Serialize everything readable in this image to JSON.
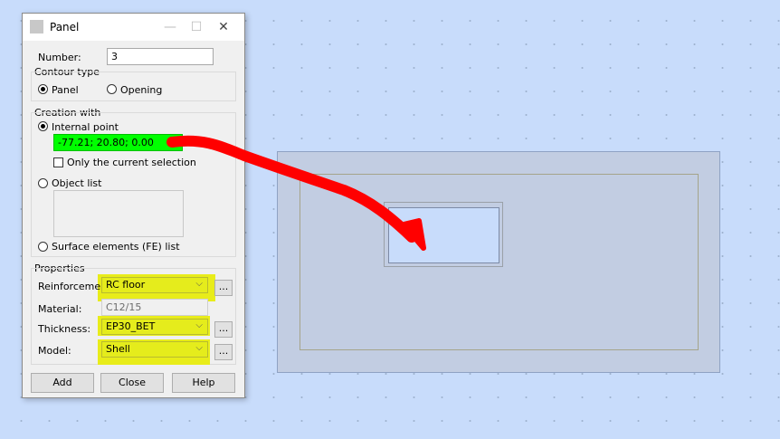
{
  "dialog": {
    "title": "Panel",
    "number_label": "Number:",
    "number_value": "3",
    "contour_type": {
      "title": "Contour type",
      "panel_label": "Panel",
      "opening_label": "Opening",
      "selected": "Panel"
    },
    "creation": {
      "title": "Creation with",
      "internal_point_label": "Internal point",
      "point_value": "-77.21; 20.80; 0.00",
      "only_selection_label": "Only the current selection",
      "object_list_label": "Object list",
      "surface_label": "Surface elements (FE) list"
    },
    "properties": {
      "title": "Properties",
      "reinforcement_label": "Reinforcement:",
      "reinforcement_value": "RC floor",
      "material_label": "Material:",
      "material_value": "C12/15",
      "thickness_label": "Thickness:",
      "thickness_value": "EP30_BET",
      "model_label": "Model:",
      "model_value": "Shell",
      "more_label": "..."
    },
    "buttons": {
      "add": "Add",
      "close": "Close",
      "help": "Help"
    }
  },
  "window_controls": {
    "minimize": "—",
    "maximize": "☐",
    "close": "✕"
  },
  "colors": {
    "highlight_green": "#00ff00",
    "highlight_yellow": "#e8ec1a",
    "annotation_arrow": "#ff0000",
    "canvas_background": "#c8dcfb"
  }
}
